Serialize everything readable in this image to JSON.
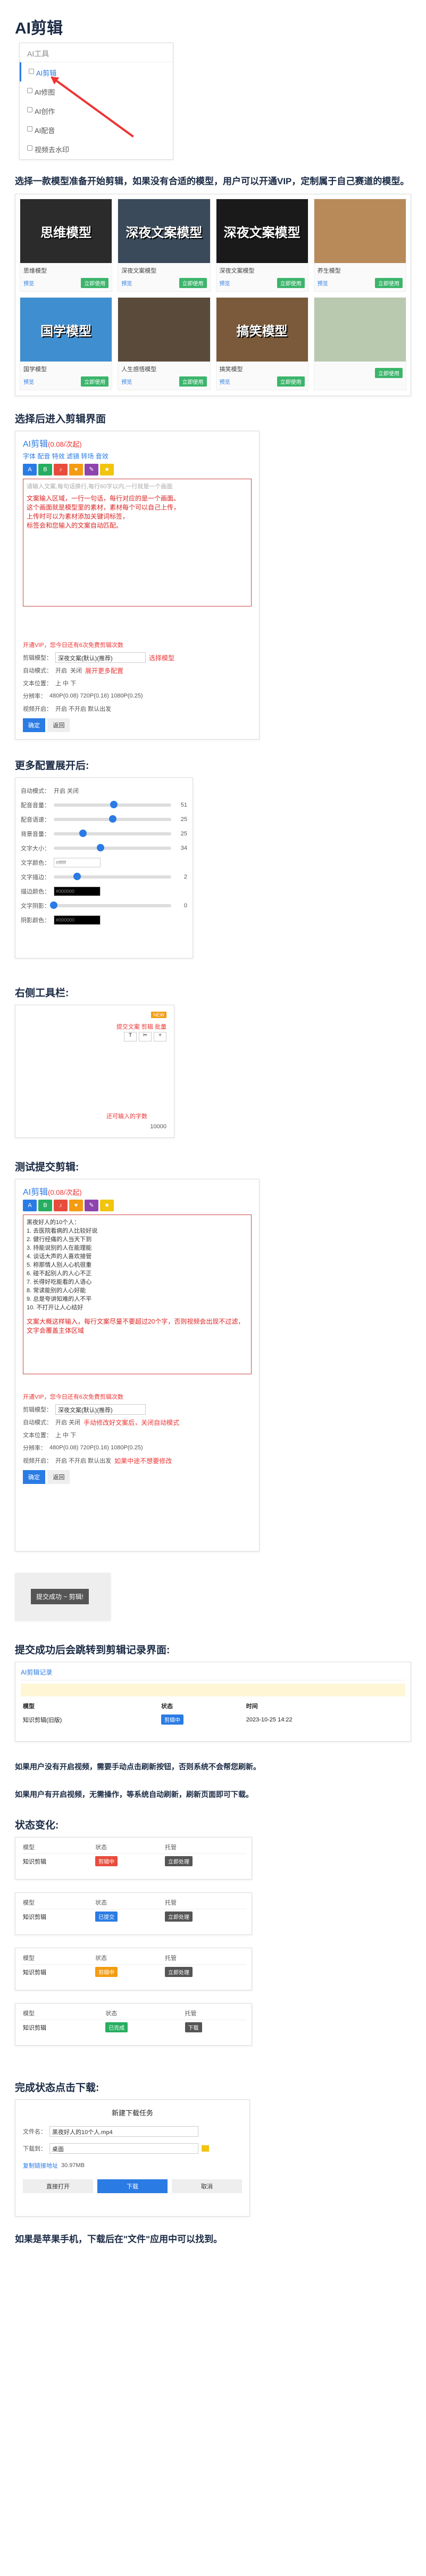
{
  "page": {
    "title": "AI剪辑",
    "section2_title": "选择一款模型准备开始剪辑，如果没有合适的模型，用户可以开通VIP，定制属于自己赛道的模型。",
    "section3_title": "选择后进入剪辑界面",
    "section4_title": "更多配置展开后:",
    "section5_title": "右侧工具栏:",
    "section6_title": "测试提交剪辑:",
    "section7_title": "提交成功后会跳转到剪辑记录界面:",
    "note1": "如果用户没有开启视频，需要手动点击刷新按钮，否则系统不会帮您刷新。",
    "note2": "如果用户有开启视频，无需操作，等系统自动刷新，刷新页面即可下载。",
    "section8_title": "状态变化:",
    "section9_title": "完成状态点击下载:",
    "footer_note": "如果是苹果手机，下载后在\"文件\"应用中可以找到。"
  },
  "menu": {
    "header": "AI工具",
    "items": [
      {
        "label": "AI剪辑",
        "icon": "scissors-icon"
      },
      {
        "label": "AI修图",
        "icon": "image-icon"
      },
      {
        "label": "AI创作",
        "icon": "pen-icon"
      },
      {
        "label": "AI配音",
        "icon": "mic-icon"
      },
      {
        "label": "视频去水印",
        "icon": "video-icon"
      }
    ]
  },
  "models": [
    {
      "name": "思维模型",
      "thumb": "思维模型",
      "preview": "预览",
      "action": "立即使用",
      "bg": "#2b2b2b"
    },
    {
      "name": "深夜文案模型",
      "thumb": "深夜文案模型",
      "preview": "预览",
      "action": "立即使用",
      "bg": "#3a4a5a"
    },
    {
      "name": "深夜文案模型",
      "thumb": "深夜文案模型",
      "preview": "预览",
      "action": "立即使用",
      "bg": "#1a1a1a"
    },
    {
      "name": "养生模型",
      "thumb": "",
      "preview": "预览",
      "action": "立即使用",
      "bg": "#b88a5a"
    },
    {
      "name": "国学模型",
      "thumb": "国学模型",
      "preview": "预览",
      "action": "立即使用",
      "bg": "#3f8fd0"
    },
    {
      "name": "人生感悟模型",
      "thumb": "",
      "preview": "预览",
      "action": "立即使用",
      "bg": "#5a4a3a"
    },
    {
      "name": "搞笑模型",
      "thumb": "搞笑模型",
      "preview": "预览",
      "action": "立即使用",
      "bg": "#7a5a3a"
    },
    {
      "name": "",
      "thumb": "",
      "preview": "",
      "action": "立即使用",
      "bg": "#b9c9b0"
    }
  ],
  "editor": {
    "title": "AI剪辑",
    "cost": "(0.08/次起)",
    "links": "字体  配音  特效  滤镜  转场  音效",
    "placeholder": "请输入文案,每句话换行,每行60字以内,一行就是一个画面",
    "tips": [
      "文案输入区域，一行一句话，每行对应的是一个画面。",
      "这个画面就是模型里的素材，素材每个可以自己上传，",
      "上传时可以为素材添加关键词标签，",
      "标签会和您输入的文案自动匹配。"
    ],
    "vip_warn": "开通VIP，您今日还有6次免费剪辑次数",
    "model_label": "剪辑模型：",
    "model_value": "深夜文案(默认)(推荐)",
    "model_hint": "选择模型",
    "auto_label": "自动模式：",
    "auto_on": "开启",
    "auto_off": "关闭",
    "more_hint": "展开更多配置",
    "pos_label": "文本位置：",
    "pos_options": "上  中  下",
    "res_label": "分辨率：",
    "res_options": "480P(0.08)  720P(0.16)  1080P(0.25)",
    "video_label": "视频开启：",
    "video_options": "开启  不开启  默认出发",
    "submit": "确定",
    "back": "返回"
  },
  "config": {
    "rows": [
      {
        "label": "自动模式：",
        "value": "开启  关闭"
      },
      {
        "label": "配音音量：",
        "value": "51",
        "pct": 0.51
      },
      {
        "label": "配音语速：",
        "value": "25",
        "pct": 0.5
      },
      {
        "label": "背景音量：",
        "value": "25",
        "pct": 0.25
      },
      {
        "label": "文字大小：",
        "value": "34",
        "pct": 0.4
      },
      {
        "label": "文字颜色：",
        "value": "#ffffff"
      },
      {
        "label": "文字描边：",
        "value": "2",
        "pct": 0.2
      },
      {
        "label": "描边颜色：",
        "value": "#000000"
      },
      {
        "label": "文字阴影：",
        "value": "0",
        "pct": 0
      },
      {
        "label": "阴影颜色：",
        "value": "#000000"
      }
    ]
  },
  "right_tools": {
    "hint": "提交文案 剪辑 批量",
    "count_hint": "还可输入的字数",
    "count": "10000"
  },
  "test_edit": {
    "lines": [
      "黑夜好人的10个人：",
      "1. 去医院看病的人比较好说",
      "2. 健行经痛的人当天下到",
      "3. 持能说别的人在能理能",
      "4. 谈话大声的人喜欢接管",
      "5. 称那情人别人心机很重",
      "6. 碰不起别人的人心不正",
      "7. 长得好吃能看的人语心",
      "8. 常读能别的人心好能",
      "9. 总是夸讲知难的人不平",
      "10. 不打开让人心结好"
    ],
    "tips": "文案大概这样输入，每行文案尽量不要超过20个字，否则视频会出现不过滤，文字会覆盖主体区域",
    "auto_hint": "手动修改好文案后，关闭自动模式",
    "video_hint": "如果中途不想要修改"
  },
  "submit_shot": {
    "label": "提交成功 ~ 剪辑!"
  },
  "records": {
    "title": "AI剪辑记录",
    "headers": [
      "模型",
      "状态",
      "时间"
    ],
    "row": [
      "知识剪辑(旧版)",
      "剪辑中",
      "2023-10-25 14:22"
    ]
  },
  "states": [
    {
      "model": "知识剪辑",
      "status": "剪辑中",
      "color": "#e74c3c",
      "action": "立即处理"
    },
    {
      "model": "知识剪辑",
      "status": "已提交",
      "color": "#2a7be4",
      "action": "立即处理"
    },
    {
      "model": "知识剪辑",
      "status": "剪辑中",
      "color": "#f39c12",
      "action": "立即处理"
    },
    {
      "model": "知识剪辑",
      "status": "已完成",
      "color": "#27ae60",
      "action": "下载"
    }
  ],
  "state_headers": [
    "模型",
    "状态",
    "托管"
  ],
  "download_dialog": {
    "title": "新建下载任务",
    "name_label": "文件名：",
    "name_value": "黑夜好人的10个人.mp4",
    "path_label": "下载到：",
    "path_value": "桌面",
    "link": "复制链接地址",
    "size": "30.97MB",
    "open_btn": "直接打开",
    "download_btn": "下载",
    "cancel_btn": "取消"
  },
  "colors": {
    "accent": "#2a7be4",
    "warn": "#e33333",
    "heading": "#1a2a44"
  }
}
